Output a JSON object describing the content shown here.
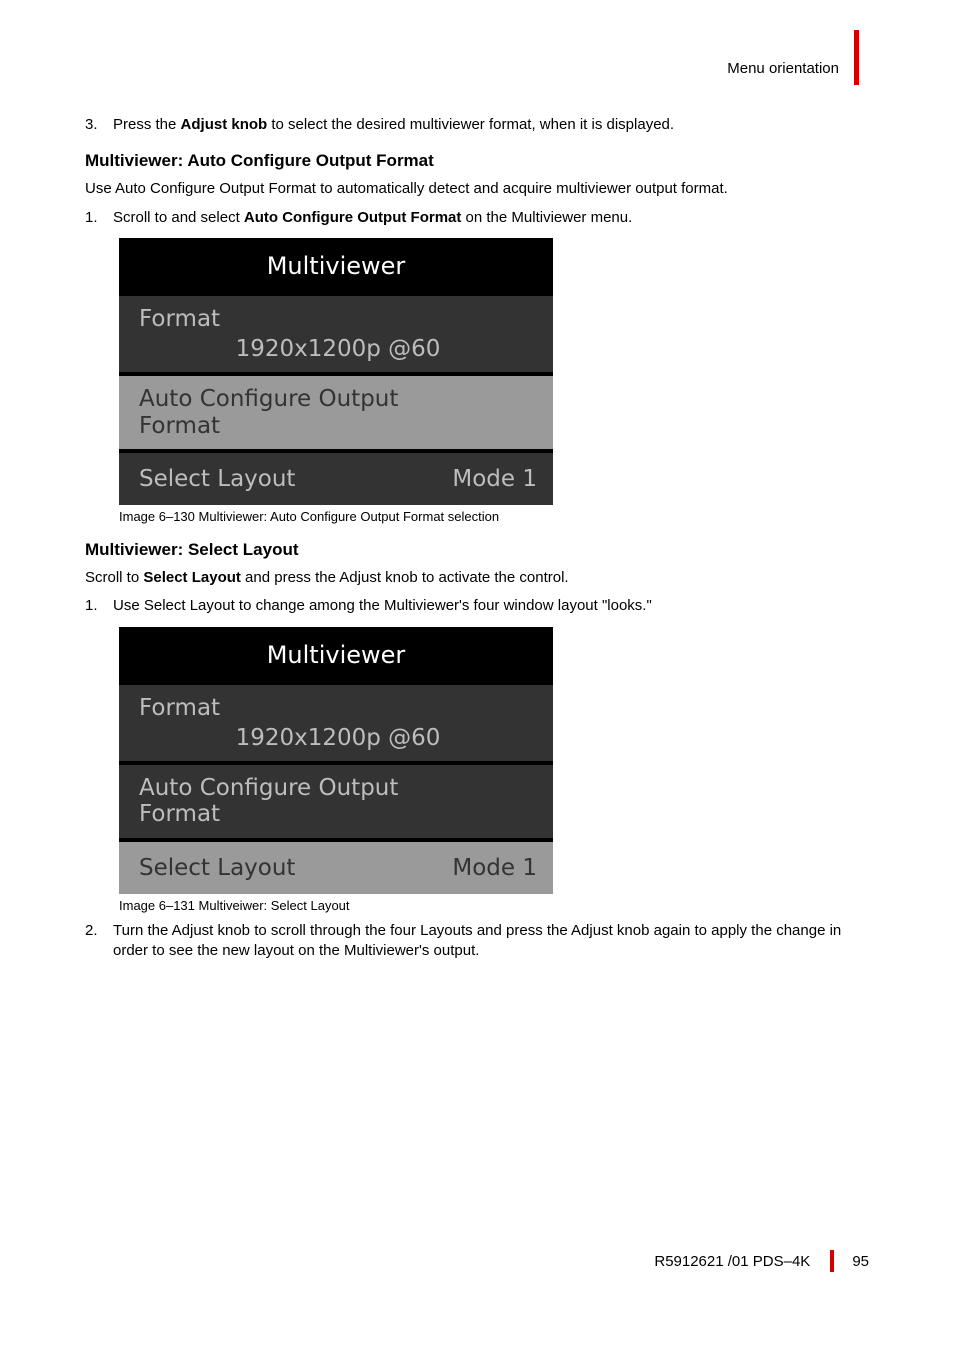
{
  "header": {
    "section": "Menu orientation"
  },
  "step3": {
    "num": "3.",
    "pre": "Press the ",
    "bold": "Adjust knob",
    "post": " to select the desired multiviewer format, when it is displayed."
  },
  "sec1": {
    "heading": "Multiviewer: Auto Configure Output Format",
    "intro": "Use Auto Configure Output Format to automatically detect and acquire multiviewer output format.",
    "step1": {
      "num": "1.",
      "pre": "Scroll to and select ",
      "bold": "Auto Configure Output Format",
      "post": " on the Multiviewer menu."
    },
    "fig": {
      "title": "Multiviewer",
      "format_label": "Format",
      "format_value": "1920x1200p @60",
      "auto_line1": "Auto Configure Output",
      "auto_line2": "Format",
      "select_layout_label": "Select Layout",
      "select_layout_value": "Mode 1"
    },
    "caption": "Image 6–130  Multiviewer: Auto Configure Output Format selection"
  },
  "sec2": {
    "heading": "Multiviewer: Select Layout",
    "intro_pre": "Scroll to ",
    "intro_bold": "Select Layout",
    "intro_post": " and press the Adjust knob to activate the control.",
    "step1": {
      "num": "1.",
      "text": "Use Select Layout to change among the Multiviewer's four window layout \"looks.\""
    },
    "fig": {
      "title": "Multiviewer",
      "format_label": "Format",
      "format_value": "1920x1200p @60",
      "auto_line1": "Auto Configure Output",
      "auto_line2": "Format",
      "select_layout_label": "Select Layout",
      "select_layout_value": "Mode 1"
    },
    "caption": "Image 6–131  Multiveiwer: Select Layout",
    "step2": {
      "num": "2.",
      "text": "Turn the Adjust knob to scroll through the four Layouts and press the Adjust knob again to apply the change in order to see the new layout on the Multiviewer's output."
    }
  },
  "footer": {
    "doc": "R5912621 /01 PDS–4K",
    "page": "95"
  }
}
